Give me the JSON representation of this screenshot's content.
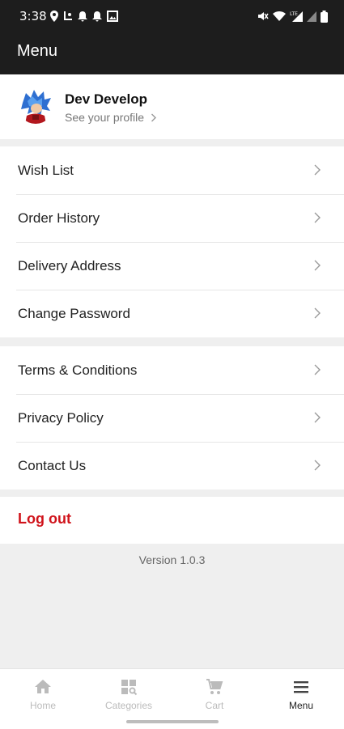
{
  "status_bar": {
    "time": "3:38",
    "left_icons": [
      "location-icon",
      "app-icon",
      "notification-bell-icon",
      "notification-bell-icon",
      "gallery-icon"
    ],
    "right_icons": [
      "mute-icon",
      "wifi-icon",
      "lte-signal-icon",
      "signal-icon",
      "battery-icon"
    ],
    "network": "LTE"
  },
  "app_bar": {
    "title": "Menu"
  },
  "profile": {
    "name": "Dev Develop",
    "subtitle": "See your profile"
  },
  "account_items": [
    {
      "label": "Wish List"
    },
    {
      "label": "Order History"
    },
    {
      "label": "Delivery Address"
    },
    {
      "label": "Change Password"
    }
  ],
  "info_items": [
    {
      "label": "Terms & Conditions"
    },
    {
      "label": "Privacy Policy"
    },
    {
      "label": "Contact Us"
    }
  ],
  "logout": {
    "label": "Log out",
    "color": "#d0131b"
  },
  "version": "Version 1.0.3",
  "bottom_nav": {
    "items": [
      {
        "label": "Home",
        "icon": "home-icon",
        "active": false
      },
      {
        "label": "Categories",
        "icon": "categories-icon",
        "active": false
      },
      {
        "label": "Cart",
        "icon": "cart-icon",
        "active": false
      },
      {
        "label": "Menu",
        "icon": "menu-icon",
        "active": true
      }
    ]
  },
  "colors": {
    "top_bar": "#1d1d1d",
    "background": "#efefef",
    "accent": "#d0131b"
  }
}
